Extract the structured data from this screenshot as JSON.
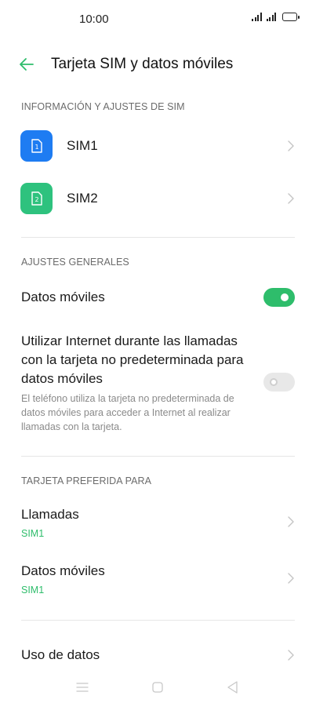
{
  "status_bar": {
    "time": "10:00"
  },
  "header": {
    "title": "Tarjeta SIM y datos móviles"
  },
  "sim_section": {
    "header": "INFORMACIÓN Y AJUSTES DE SIM",
    "items": [
      {
        "label": "SIM1",
        "badge": "1",
        "color": "#1e7cf2"
      },
      {
        "label": "SIM2",
        "badge": "2",
        "color": "#2ec27e"
      }
    ]
  },
  "general_section": {
    "header": "AJUSTES GENERALES",
    "mobile_data": {
      "label": "Datos móviles",
      "enabled": true
    },
    "internet_calls": {
      "label": "Utilizar Internet durante las llamadas con la tarjeta no predeterminada para datos móviles",
      "description": "El teléfono utiliza la tarjeta no predeterminada de datos móviles para acceder a Internet al realizar llamadas con la tarjeta.",
      "enabled": false
    }
  },
  "preferred_section": {
    "header": "TARJETA PREFERIDA PARA",
    "calls": {
      "label": "Llamadas",
      "value": "SIM1"
    },
    "data": {
      "label": "Datos móviles",
      "value": "SIM1"
    }
  },
  "data_usage": {
    "label": "Uso de datos"
  },
  "colors": {
    "accent": "#2ebd6b",
    "sim1": "#1e7cf2",
    "sim2": "#2ec27e"
  }
}
